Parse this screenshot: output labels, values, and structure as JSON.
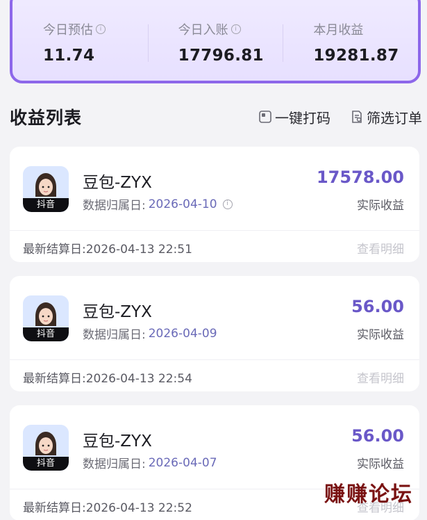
{
  "stats": [
    {
      "label": "今日预估",
      "value": "11.74",
      "info": true
    },
    {
      "label": "今日入账",
      "value": "17796.81",
      "info": true
    },
    {
      "label": "本月收益",
      "value": "19281.87",
      "info": false
    }
  ],
  "section": {
    "title": "收益列表",
    "action_code": "一键打码",
    "action_filter": "筛选订单"
  },
  "cards": [
    {
      "avatar_badge": "抖音",
      "title": "豆包-ZYX",
      "date_label": "数据归属日:",
      "date": "2026-04-10",
      "amount": "17578.00",
      "amount_label": "实际收益",
      "settle": "最新结算日:2026-04-13 22:51",
      "detail": "查看明细",
      "info": true
    },
    {
      "avatar_badge": "抖音",
      "title": "豆包-ZYX",
      "date_label": "数据归属日:",
      "date": "2026-04-09",
      "amount": "56.00",
      "amount_label": "实际收益",
      "settle": "最新结算日:2026-04-13 22:54",
      "detail": "查看明细",
      "info": false
    },
    {
      "avatar_badge": "抖音",
      "title": "豆包-ZYX",
      "date_label": "数据归属日:",
      "date": "2026-04-07",
      "amount": "56.00",
      "amount_label": "实际收益",
      "settle": "最新结算日:2026-04-13 22:52",
      "detail": "查看明细",
      "info": false
    }
  ],
  "watermark": "赚赚论坛",
  "colors": {
    "accent": "#8d67ea",
    "amount": "#6a58c8",
    "date": "#6a6ab8"
  }
}
